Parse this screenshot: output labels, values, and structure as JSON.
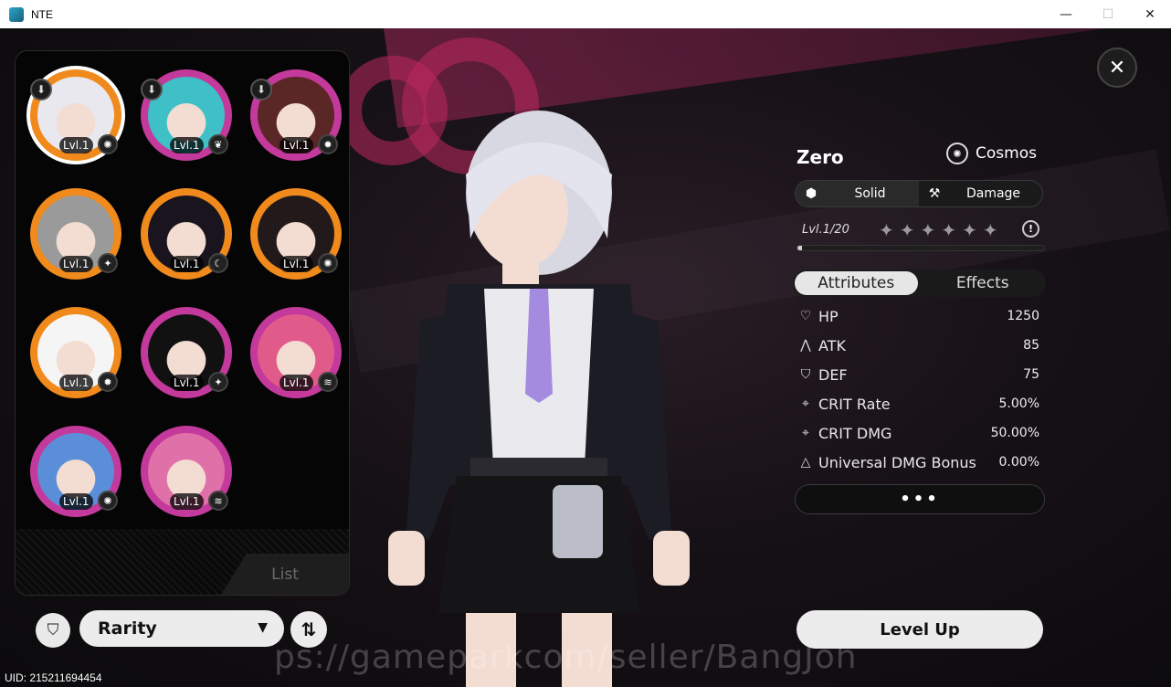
{
  "window": {
    "title": "NTE",
    "min_glyph": "—",
    "max_glyph": "☐",
    "close_glyph": "✕"
  },
  "list_panel": {
    "tab_label": "List",
    "characters": [
      {
        "level": "Lvl.1",
        "ring": "#f08a1c",
        "face": "#c9c9cf",
        "hair": "#e8e8ee",
        "elem_icon": "cosmos-icon",
        "elem_glyph": "✺",
        "pinned": true,
        "selected": true
      },
      {
        "level": "Lvl.1",
        "ring": "#c43a9c",
        "face": "#7fd7df",
        "hair": "#3ec0c6",
        "elem_icon": "leaf-icon",
        "elem_glyph": "❦",
        "pinned": true,
        "selected": false
      },
      {
        "level": "Lvl.1",
        "ring": "#c43a9c",
        "face": "#8a3a2a",
        "hair": "#5a2626",
        "elem_icon": "flame-icon",
        "elem_glyph": "✹",
        "pinned": true,
        "selected": false
      },
      {
        "level": "Lvl.1",
        "ring": "#f08a1c",
        "face": "#bdbdbd",
        "hair": "#9a9a9a",
        "elem_icon": "star-icon",
        "elem_glyph": "✦",
        "pinned": false,
        "selected": false
      },
      {
        "level": "Lvl.1",
        "ring": "#f08a1c",
        "face": "#2b2430",
        "hair": "#1a141e",
        "elem_icon": "moon-icon",
        "elem_glyph": "☾",
        "pinned": false,
        "selected": false
      },
      {
        "level": "Lvl.1",
        "ring": "#f08a1c",
        "face": "#3a2b2b",
        "hair": "#221a1a",
        "elem_icon": "cosmos-icon",
        "elem_glyph": "✺",
        "pinned": false,
        "selected": false
      },
      {
        "level": "Lvl.1",
        "ring": "#f08a1c",
        "face": "#e8e8ee",
        "hair": "#f5f5f5",
        "elem_icon": "flame-icon",
        "elem_glyph": "✹",
        "pinned": false,
        "selected": false
      },
      {
        "level": "Lvl.1",
        "ring": "#c43a9c",
        "face": "#2a2a30",
        "hair": "#111",
        "elem_icon": "star-icon",
        "elem_glyph": "✦",
        "pinned": false,
        "selected": false
      },
      {
        "level": "Lvl.1",
        "ring": "#c43a9c",
        "face": "#e88ca8",
        "hair": "#e05a8a",
        "elem_icon": "wave-icon",
        "elem_glyph": "≋",
        "pinned": false,
        "selected": false
      },
      {
        "level": "Lvl.1",
        "ring": "#c43a9c",
        "face": "#8fb8e8",
        "hair": "#5a8ed8",
        "elem_icon": "cosmos-icon",
        "elem_glyph": "✺",
        "pinned": false,
        "selected": false
      },
      {
        "level": "Lvl.1",
        "ring": "#c43a9c",
        "face": "#f0a8c8",
        "hair": "#e070a8",
        "elem_icon": "wave-icon",
        "elem_glyph": "≋",
        "pinned": false,
        "selected": false
      }
    ]
  },
  "controls": {
    "filter_glyph": "⛉",
    "rarity_label": "Rarity",
    "rarity_caret": "▼",
    "sort_glyph": "⇅"
  },
  "uid": "UID: 215211694454",
  "close_glyph": "✕",
  "character": {
    "name": "Zero",
    "path_label": "Cosmos",
    "path_glyph": "✺",
    "tags": [
      {
        "icon": "cube-icon",
        "glyph": "⬢",
        "label": "Solid"
      },
      {
        "icon": "hammer-icon",
        "glyph": "⚒",
        "label": "Damage"
      }
    ],
    "level_label": "Lvl.",
    "level_value": "1",
    "level_max": "/20",
    "level_progress": 0.02,
    "stars": [
      "✦",
      "✦",
      "✦",
      "✦",
      "✦",
      "✦"
    ],
    "info_glyph": "!"
  },
  "tabs": {
    "attributes": "Attributes",
    "effects": "Effects"
  },
  "attributes": [
    {
      "icon": "heart-icon",
      "glyph": "♡",
      "name": "HP",
      "value": "1250"
    },
    {
      "icon": "attack-icon",
      "glyph": "⋀",
      "name": "ATK",
      "value": "85"
    },
    {
      "icon": "shield-icon",
      "glyph": "⛉",
      "name": "DEF",
      "value": "75"
    },
    {
      "icon": "crosshair-icon",
      "glyph": "⌖",
      "name": "CRIT Rate",
      "value": "5.00%"
    },
    {
      "icon": "crosshair-icon",
      "glyph": "⌖",
      "name": "CRIT DMG",
      "value": "50.00%"
    },
    {
      "icon": "triangle-icon",
      "glyph": "△",
      "name": "Universal DMG Bonus",
      "value": "0.00%"
    }
  ],
  "more_label": "•••",
  "level_up_label": "Level Up",
  "watermark": "ps://gameparkcom/seller/BangJoh",
  "colors": {
    "accent_orange": "#f08a1c",
    "accent_purple": "#c43a9c",
    "button_light": "#ececec"
  }
}
